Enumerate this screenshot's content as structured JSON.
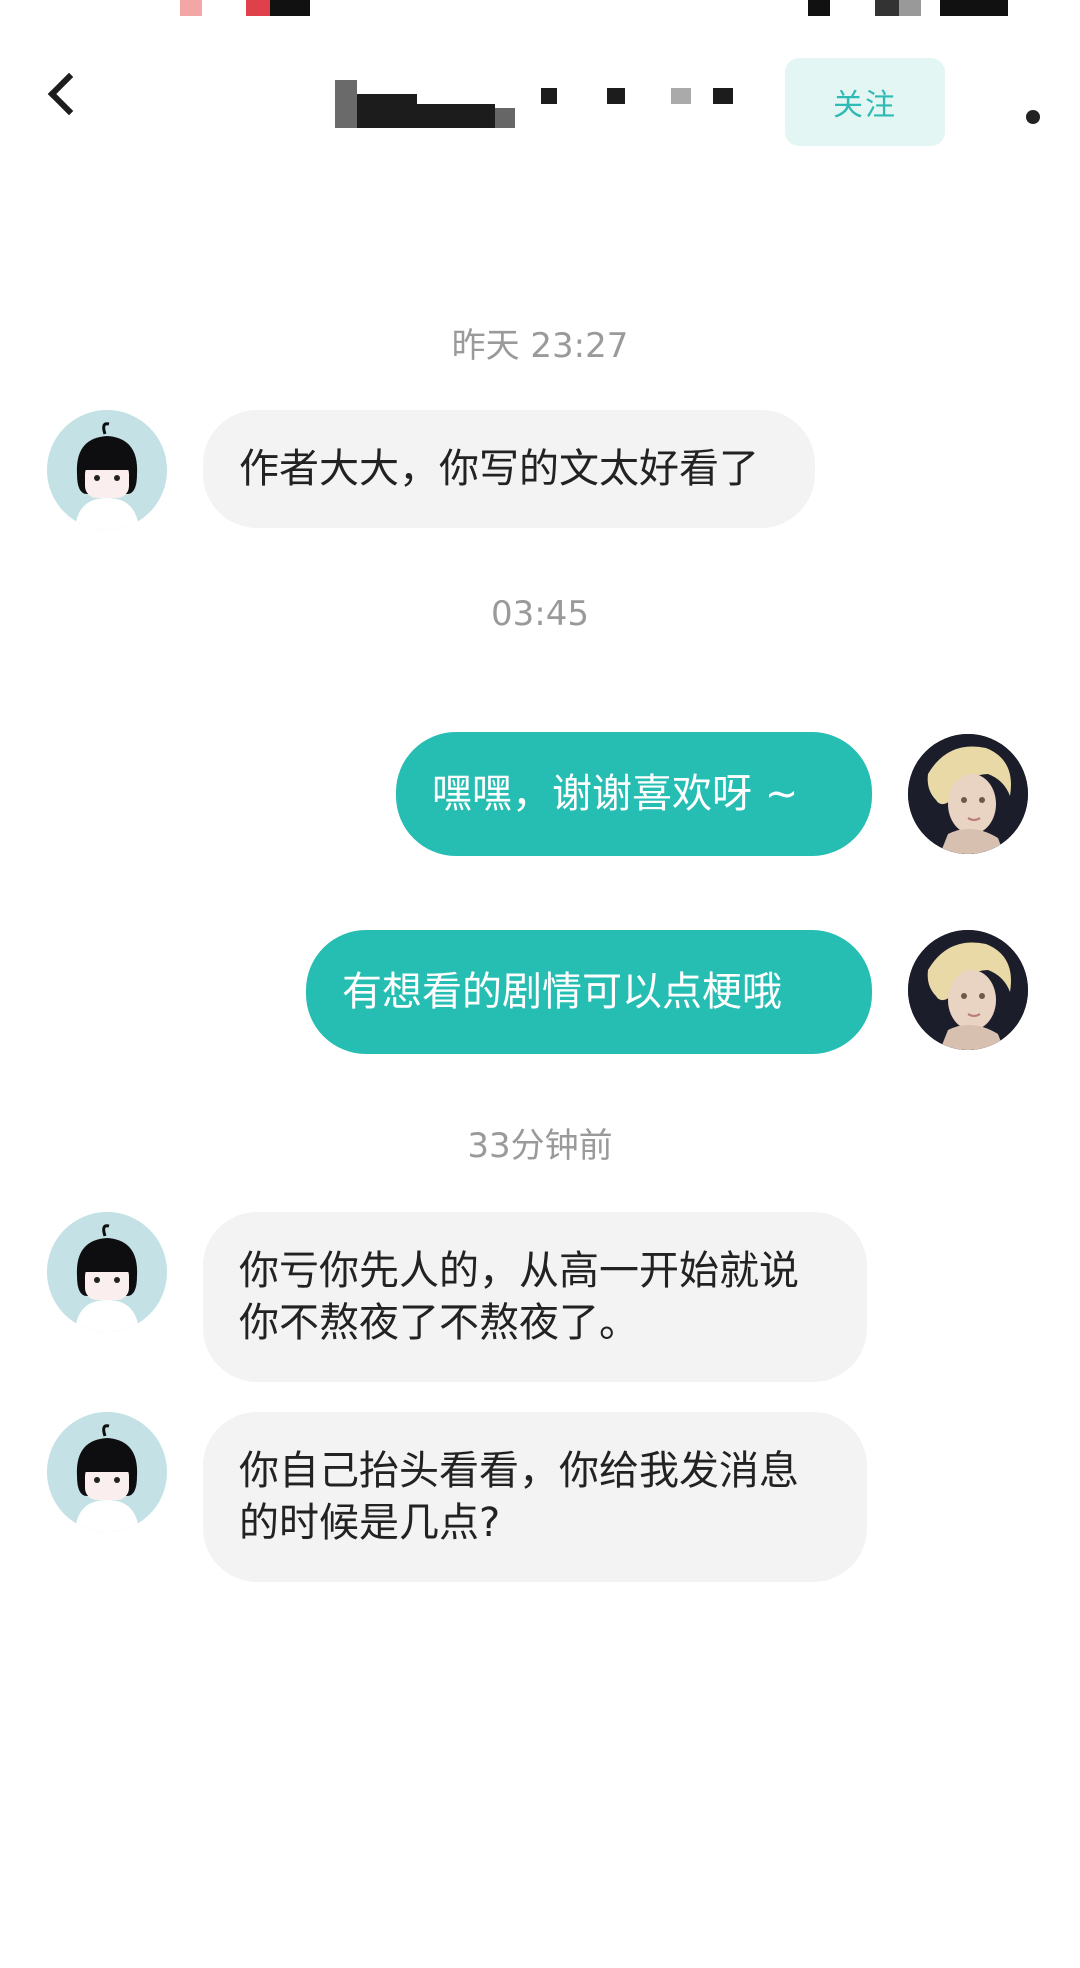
{
  "header": {
    "back_icon": "chevron-left-icon",
    "follow_label": "关注",
    "more_icon": "more-dot-icon"
  },
  "colors": {
    "accent": "#26bdb2",
    "follow_bg": "#e4f6f4",
    "incoming_bubble": "#f3f3f3",
    "timestamp": "#9a9a9a"
  },
  "messages": [
    {
      "type": "time",
      "text": "昨天 23:27"
    },
    {
      "type": "incoming",
      "lines": [
        "作者大大，你写的文太好看了"
      ]
    },
    {
      "type": "time",
      "text": "03:45"
    },
    {
      "type": "outgoing",
      "lines": [
        "嘿嘿，谢谢喜欢呀 ~"
      ]
    },
    {
      "type": "outgoing",
      "lines": [
        "有想看的剧情可以点梗哦"
      ]
    },
    {
      "type": "time",
      "text": "33分钟前"
    },
    {
      "type": "incoming",
      "lines": [
        "你亏你先人的，从高一开始就说",
        "你不熬夜了不熬夜了。"
      ]
    },
    {
      "type": "incoming",
      "lines": [
        "你自己抬头看看，你给我发消息",
        "的时候是几点?"
      ]
    }
  ]
}
